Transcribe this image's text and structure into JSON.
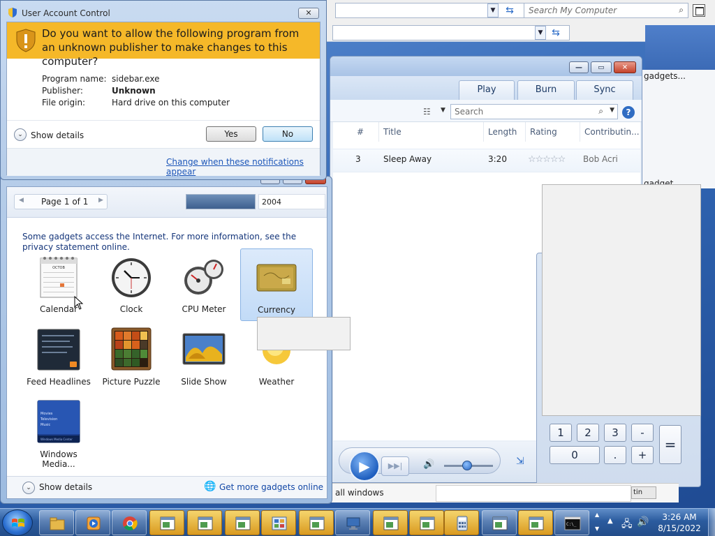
{
  "explorer": {
    "search_placeholder": "Search My Computer"
  },
  "background_windows": {
    "gadgets_label": "gadgets...",
    "gadget_label": "gadget"
  },
  "uac": {
    "title": "User Account Control",
    "question": "Do you want to allow the following program from an unknown publisher to make changes to this computer?",
    "program_name_label": "Program name:",
    "program_name_value": "sidebar.exe",
    "publisher_label": "Publisher:",
    "publisher_value": "Unknown",
    "file_origin_label": "File origin:",
    "file_origin_value": "Hard drive on this computer",
    "show_details": "Show details",
    "yes": "Yes",
    "no": "No",
    "change_link": "Change when these notifications appear",
    "banner_color": "#f5b829"
  },
  "media_player": {
    "tabs": [
      "Play",
      "Burn",
      "Sync"
    ],
    "search_placeholder": "Search",
    "help": "?",
    "columns": [
      "#",
      "Title",
      "Length",
      "Rating",
      "Contributin..."
    ],
    "track": {
      "number": "3",
      "title": "Sleep Away",
      "length": "3:20",
      "rating": 0,
      "contributing": "Bob Acri"
    }
  },
  "calculator": {
    "keys": [
      "1",
      "2",
      "3",
      "-",
      "0",
      ".",
      "+",
      "="
    ]
  },
  "preview_strip": {
    "label": "all windows",
    "tn": "tin"
  },
  "gallery": {
    "page_label": "Page 1 of 1",
    "year": "2004",
    "info": "Some gadgets access the Internet.  For more information, see the privacy statement online.",
    "gadgets": [
      {
        "name": "Calendar"
      },
      {
        "name": "Clock"
      },
      {
        "name": "CPU Meter"
      },
      {
        "name": "Currency"
      },
      {
        "name": "Feed Headlines"
      },
      {
        "name": "Picture Puzzle"
      },
      {
        "name": "Slide Show"
      },
      {
        "name": "Weather"
      },
      {
        "name": "Windows Media..."
      }
    ],
    "selected": "Currency",
    "calendar_month": "OCTOB",
    "media_lines": [
      "Movies",
      "Television",
      "Music"
    ],
    "media_footer": "Windows Media Center",
    "show_details": "Show details",
    "get_more": "Get more gadgets online"
  },
  "taskbar": {
    "clock_time": "3:26 AM",
    "clock_date": "8/15/2022",
    "accent": "#2b5b9e"
  }
}
